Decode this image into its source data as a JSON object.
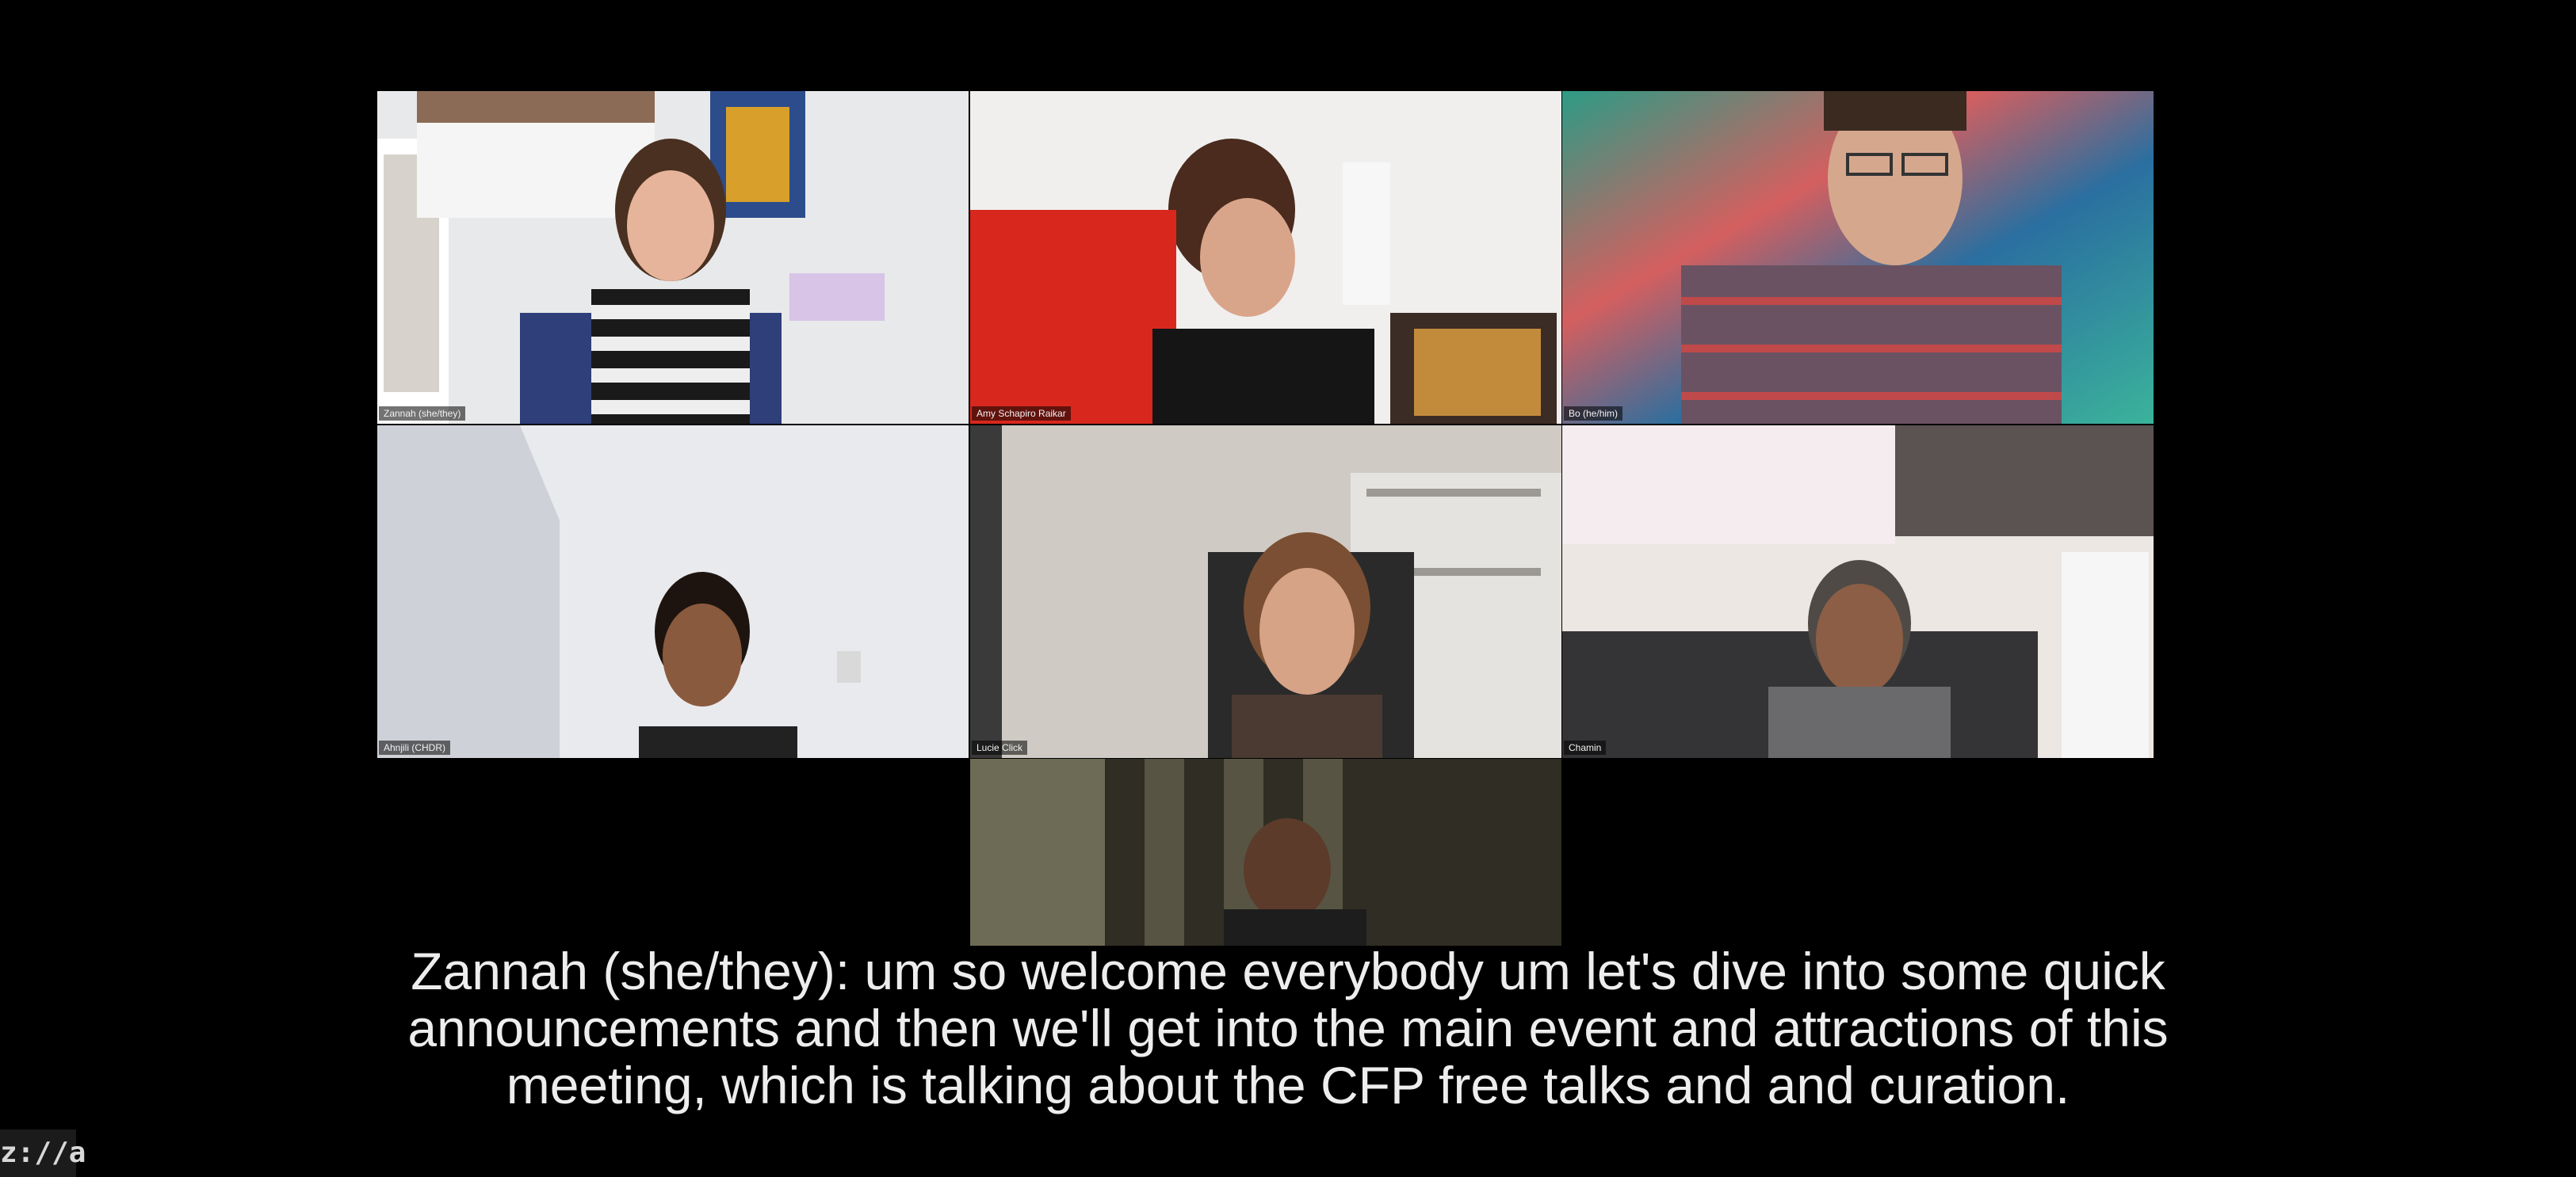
{
  "participants": [
    {
      "name": "Zannah (she/they)"
    },
    {
      "name": "Amy Schapiro Raikar"
    },
    {
      "name": "Bo (he/him)"
    },
    {
      "name": "Ahnjili (CHDR)"
    },
    {
      "name": "Lucie Click"
    },
    {
      "name": "Chamin"
    },
    {
      "name": ""
    }
  ],
  "caption": {
    "text": "Zannah (she/they): um so welcome everybody um let's dive into some quick announcements and then we'll get into the main event and attractions of this meeting, which is talking about the CFP free talks and and curation."
  },
  "logo": {
    "text": "z://a"
  },
  "colors": {
    "background": "#000000",
    "caption_text": "#ededed",
    "name_tag_bg": "rgba(0,0,0,0.55)"
  }
}
